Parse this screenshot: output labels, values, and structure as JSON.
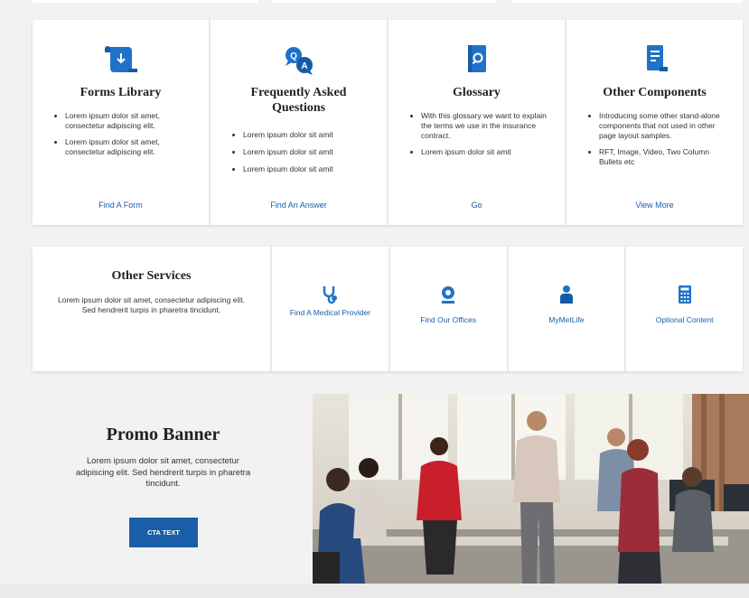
{
  "cards": [
    {
      "title": "Forms Library",
      "icon": "scroll-download-icon",
      "bullets": [
        "Lorem ipsum dolor sit amet, consectetur adipiscing elit.",
        "Lorem ipsum dolor sit amet, consectetur adipiscing elit."
      ],
      "link": "Find A Form"
    },
    {
      "title": "Frequently Asked Questions",
      "icon": "qa-bubbles-icon",
      "bullets": [
        "Lorem ipsum dolor sit amit",
        "Lorem ipsum dolor sit amit",
        "Lorem ipsum dolor sit amit"
      ],
      "link": "Find An Answer"
    },
    {
      "title": "Glossary",
      "icon": "book-search-icon",
      "bullets": [
        "With this glossary we want to explain the terms we use in the insurance contract.",
        "Lorem ipsum dolor sit amit"
      ],
      "link": "Go"
    },
    {
      "title": "Other Components",
      "icon": "document-icon",
      "bullets": [
        "Introducing some other stand-alone components that not used in other page layout samples.",
        "RFT, Image, Video, Two Column Bullets etc"
      ],
      "link": "View More"
    }
  ],
  "services": {
    "title": "Other Services",
    "description": "Lorem ipsum dolor sit amet, consectetur adipiscing elit. Sed hendrerit turpis in pharetra tincidunt.",
    "items": [
      {
        "label": "Find A Medical Provider",
        "icon": "stethoscope-icon"
      },
      {
        "label": "Find Our Offices",
        "icon": "location-pin-icon"
      },
      {
        "label": "MyMetLife",
        "icon": "user-icon"
      },
      {
        "label": "Optional Content",
        "icon": "calculator-icon"
      }
    ]
  },
  "promo": {
    "title": "Promo Banner",
    "description": "Lorem ipsum dolor sit amet, consectetur adipiscing elit. Sed hendrerit turpis in pharetra tincidunt.",
    "cta": "CTA TEXT"
  },
  "colors": {
    "accent": "#1a5ea8",
    "icon_blue": "#1e73c9",
    "background": "#f2f2f2"
  }
}
